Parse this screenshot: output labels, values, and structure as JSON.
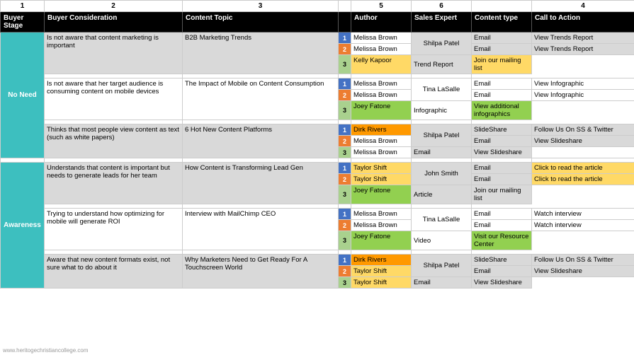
{
  "columns": {
    "nums": [
      "1",
      "2",
      "3",
      "",
      "5",
      "6",
      "",
      "4"
    ],
    "headers": [
      "Buyer Stage",
      "Buyer Consideration",
      "Content Topic",
      "",
      "Author",
      "Sales Expert",
      "Content type",
      "Call to Action"
    ]
  },
  "sections": [
    {
      "stage": "No Need",
      "stage_rowspan": 9,
      "groups": [
        {
          "consideration": "Is not aware that content marketing is important",
          "topic": "B2B Marketing Trends",
          "rows": [
            {
              "num": "1",
              "num_class": "num1",
              "author": "Melissa Brown",
              "author_class": "author-default",
              "sales": "Shilpa Patel",
              "sales_rowspan": 2,
              "ctype": "Email",
              "cta": "View Trends Report",
              "cta_class": ""
            },
            {
              "num": "2",
              "num_class": "num2",
              "author": "Melissa Brown",
              "author_class": "author-default",
              "sales": "",
              "sales_rowspan": 0,
              "ctype": "Email",
              "cta": "View Trends Report",
              "cta_class": ""
            },
            {
              "num": "3",
              "num_class": "num3",
              "author": "Kelly Kapoor",
              "author_class": "author-yellow",
              "sales": "",
              "sales_rowspan": 0,
              "ctype": "Trend Report",
              "cta": "Join our mailing list",
              "cta_class": "cta-yellow"
            }
          ]
        },
        {
          "consideration": "Is not aware that her target audience is consuming content on mobile devices",
          "topic": "The Impact of Mobile on Content Consumption",
          "rows": [
            {
              "num": "1",
              "num_class": "num1",
              "author": "Melissa Brown",
              "author_class": "author-default",
              "sales": "Tina LaSalle",
              "sales_rowspan": 2,
              "ctype": "Email",
              "cta": "View Infographic",
              "cta_class": ""
            },
            {
              "num": "2",
              "num_class": "num2",
              "author": "Melissa Brown",
              "author_class": "author-default",
              "sales": "",
              "sales_rowspan": 0,
              "ctype": "Email",
              "cta": "View Infographic",
              "cta_class": ""
            },
            {
              "num": "3",
              "num_class": "num3",
              "author": "Joey Fatone",
              "author_class": "author-green",
              "sales": "",
              "sales_rowspan": 0,
              "ctype": "Infographic",
              "cta": "View additional infographics",
              "cta_class": "cta-green"
            }
          ]
        },
        {
          "consideration": "Thinks that most people view content as text (such as white papers)",
          "topic": "6 Hot New Content Platforms",
          "rows": [
            {
              "num": "1",
              "num_class": "num1",
              "author": "Dirk Rivers",
              "author_class": "author-orange",
              "sales": "Shilpa Patel",
              "sales_rowspan": 2,
              "ctype": "SlideShare",
              "cta": "Follow Us On SS & Twitter",
              "cta_class": ""
            },
            {
              "num": "2",
              "num_class": "num2",
              "author": "Melissa Brown",
              "author_class": "author-default",
              "sales": "",
              "sales_rowspan": 0,
              "ctype": "Email",
              "cta": "View Slideshare",
              "cta_class": ""
            },
            {
              "num": "3",
              "num_class": "num3",
              "author": "Melissa Brown",
              "author_class": "author-default",
              "sales": "",
              "sales_rowspan": 0,
              "ctype": "Email",
              "cta": "View Slideshare",
              "cta_class": ""
            }
          ]
        }
      ]
    },
    {
      "stage": "Awareness",
      "stage_rowspan": 9,
      "groups": [
        {
          "consideration": "Understands that content is important but needs to generate leads for her team",
          "topic": "How Content is Transforming Lead Gen",
          "rows": [
            {
              "num": "1",
              "num_class": "num1",
              "author": "Taylor Shift",
              "author_class": "author-yellow",
              "sales": "John Smith",
              "sales_rowspan": 2,
              "ctype": "Email",
              "cta": "Click to read the article",
              "cta_class": "cta-yellow"
            },
            {
              "num": "2",
              "num_class": "num2",
              "author": "Taylor Shift",
              "author_class": "author-yellow",
              "sales": "",
              "sales_rowspan": 0,
              "ctype": "Email",
              "cta": "Click to read the article",
              "cta_class": "cta-yellow"
            },
            {
              "num": "3",
              "num_class": "num3",
              "author": "Joey Fatone",
              "author_class": "author-green",
              "sales": "",
              "sales_rowspan": 0,
              "ctype": "Article",
              "cta": "Join our mailing list",
              "cta_class": ""
            }
          ]
        },
        {
          "consideration": "Trying to understand how optimizing for mobile will generate ROI",
          "topic": "Interview with MailChimp CEO",
          "rows": [
            {
              "num": "1",
              "num_class": "num1",
              "author": "Melissa Brown",
              "author_class": "author-default",
              "sales": "Tina LaSalle",
              "sales_rowspan": 2,
              "ctype": "Email",
              "cta": "Watch interview",
              "cta_class": ""
            },
            {
              "num": "2",
              "num_class": "num2",
              "author": "Melissa Brown",
              "author_class": "author-default",
              "sales": "",
              "sales_rowspan": 0,
              "ctype": "Email",
              "cta": "Watch interview",
              "cta_class": ""
            },
            {
              "num": "3",
              "num_class": "num3",
              "author": "Joey Fatone",
              "author_class": "author-green",
              "sales": "",
              "sales_rowspan": 0,
              "ctype": "Video",
              "cta": "Visit our Resource Center",
              "cta_class": "cta-green"
            }
          ]
        },
        {
          "consideration": "Aware that new content formats exist, not sure what to do about it",
          "topic": "Why Marketers Need to Get Ready For A Touchscreen World",
          "rows": [
            {
              "num": "1",
              "num_class": "num1",
              "author": "Dirk Rivers",
              "author_class": "author-orange",
              "sales": "Shilpa Patel",
              "sales_rowspan": 2,
              "ctype": "SlideShare",
              "cta": "Follow Us On SS & Twitter",
              "cta_class": ""
            },
            {
              "num": "2",
              "num_class": "num2",
              "author": "Taylor Shift",
              "author_class": "author-yellow",
              "sales": "",
              "sales_rowspan": 0,
              "ctype": "Email",
              "cta": "View Slideshare",
              "cta_class": ""
            },
            {
              "num": "3",
              "num_class": "num3",
              "author": "Taylor Shift",
              "author_class": "author-yellow",
              "sales": "",
              "sales_rowspan": 0,
              "ctype": "Email",
              "cta": "View Slideshare",
              "cta_class": ""
            }
          ]
        }
      ]
    }
  ],
  "watermark": "www.heritogechristiancollege.com"
}
